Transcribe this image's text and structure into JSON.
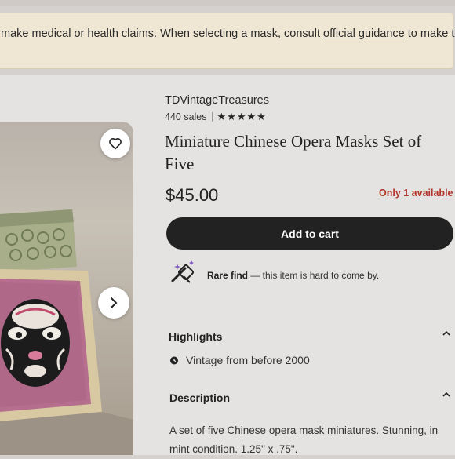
{
  "banner": {
    "text_before": "make medical or health claims. When selecting a mask, consult ",
    "link": "official guidance",
    "text_after": " to make the"
  },
  "listing": {
    "shop_name": "TDVintageTreasures",
    "sales": "440 sales",
    "rating_stars": "★★★★★",
    "title": "Miniature Chinese Opera Masks Set of Five",
    "price": "$45.00",
    "stock": "Only 1 available",
    "cart_label": "Add to cart",
    "rare_bold": "Rare find",
    "rare_rest": " — this item is hard to come by."
  },
  "highlights": {
    "title": "Highlights",
    "items": [
      "Vintage from before 2000"
    ]
  },
  "description": {
    "title": "Description",
    "text": "A set of five Chinese opera mask miniatures. Stunning, in mint condition. 1.25\" x .75\"."
  },
  "icons": {
    "favorite": "heart-icon",
    "next": "chevron-right-icon",
    "rare": "magic-wand-icon",
    "highlight": "clock-icon",
    "collapse": "chevron-up-icon"
  },
  "colors": {
    "accent_dark": "#222222",
    "stock_red": "#b3362d",
    "banner_bg": "#efe6d3"
  }
}
